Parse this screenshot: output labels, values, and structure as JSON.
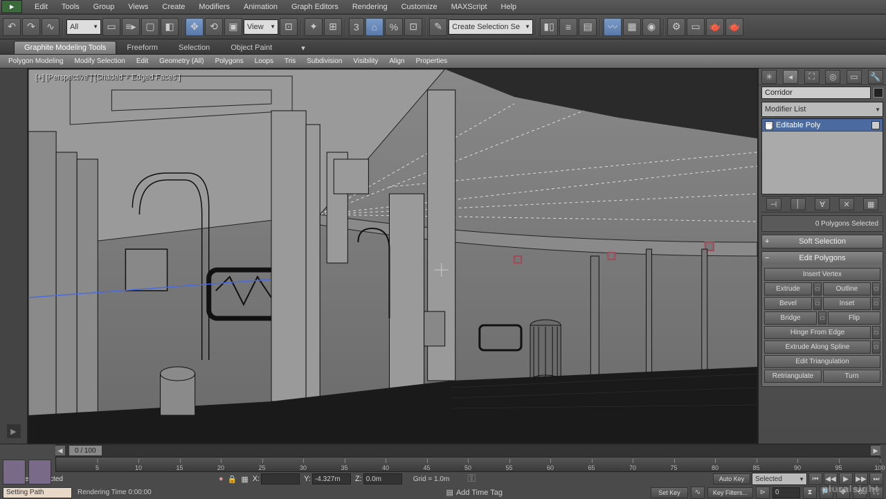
{
  "menu": {
    "items": [
      "Edit",
      "Tools",
      "Group",
      "Views",
      "Create",
      "Modifiers",
      "Animation",
      "Graph Editors",
      "Rendering",
      "Customize",
      "MAXScript",
      "Help"
    ]
  },
  "toolbar": {
    "filter": "All",
    "ref": "View",
    "selset": "Create Selection Se"
  },
  "ribbon": {
    "tabs": [
      "Graphite Modeling Tools",
      "Freeform",
      "Selection",
      "Object Paint"
    ],
    "sub": [
      "Polygon Modeling",
      "Modify Selection",
      "Edit",
      "Geometry (All)",
      "Polygons",
      "Loops",
      "Tris",
      "Subdivision",
      "Visibility",
      "Align",
      "Properties"
    ]
  },
  "viewport": {
    "label": "[+] [Perspective ] [Shaded + Edged Faces ]"
  },
  "panel": {
    "object_name": "Corridor",
    "mod_list": "Modifier List",
    "stack_item": "Editable Poly",
    "poly_count": "0 Polygons Selected",
    "rollouts": {
      "soft": "Soft Selection",
      "edit": "Edit Polygons",
      "insert_vertex": "Insert Vertex",
      "extrude": "Extrude",
      "outline": "Outline",
      "bevel": "Bevel",
      "inset": "Inset",
      "bridge": "Bridge",
      "flip": "Flip",
      "hinge": "Hinge From Edge",
      "extrude_spline": "Extrude Along Spline",
      "edit_tri": "Edit Triangulation",
      "retri": "Retriangulate",
      "turn": "Turn"
    }
  },
  "timeline": {
    "frame": "0 / 100",
    "ticks": [
      5,
      10,
      15,
      20,
      25,
      30,
      35,
      40,
      45,
      50,
      55,
      60,
      65,
      70,
      75,
      80,
      85,
      90,
      95,
      100
    ],
    "selection": "1 Object Selected",
    "x": "",
    "y": "-4.327m",
    "z": "0.0m",
    "grid": "Grid = 1.0m",
    "autokey": "Auto Key",
    "setkey": "Set Key",
    "selected": "Selected",
    "keyfilters": "Key Filters...",
    "frame_cur": "0",
    "prompt": "Setting Path",
    "render": "Rendering Time 0:00:00",
    "timetag": "Add Time Tag"
  },
  "watermark": "pluralsight"
}
